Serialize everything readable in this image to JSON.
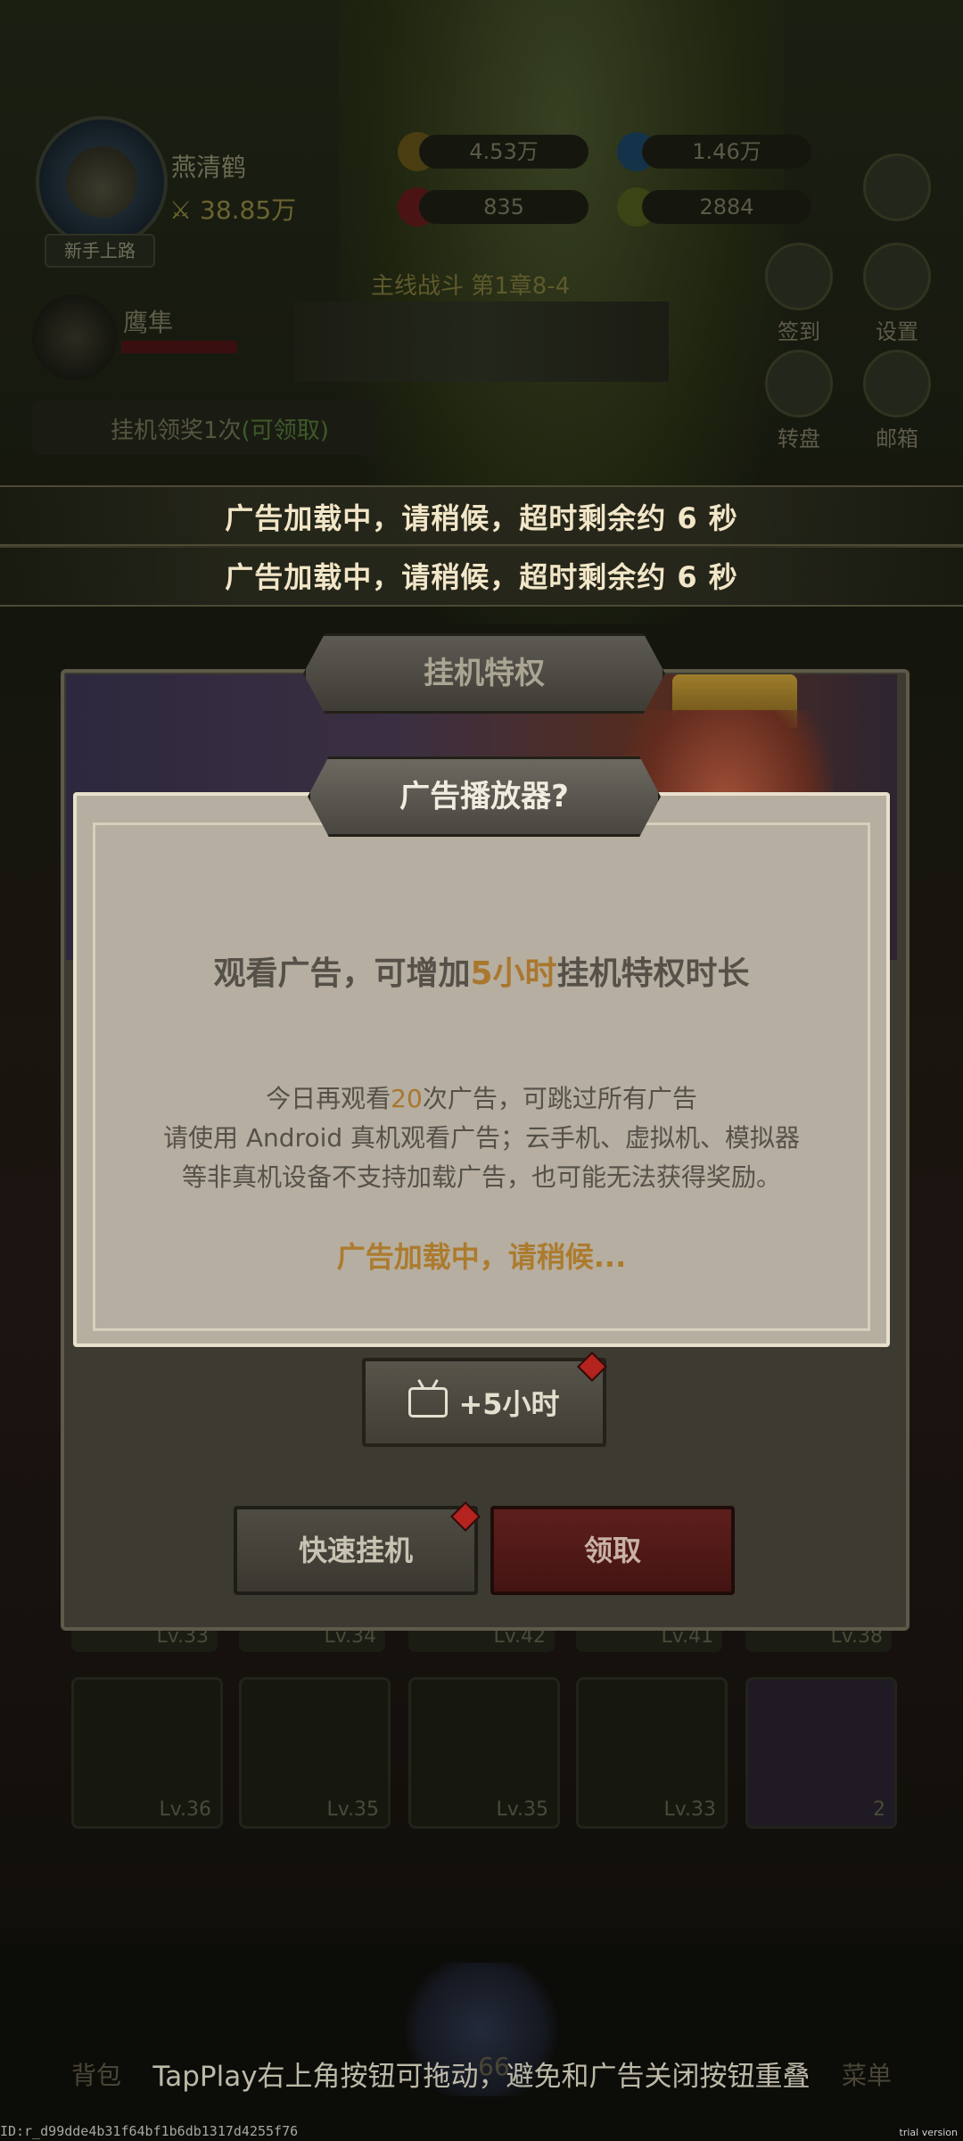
{
  "player": {
    "name": "燕清鹤",
    "power": "38.85万",
    "title_tag": "新手上路"
  },
  "resources": {
    "gold": "4.53万",
    "diamond": "1.46万",
    "gem": "835",
    "material": "2884"
  },
  "side_menu": {
    "checkin": "签到",
    "settings": "设置",
    "wheel": "转盘",
    "mail": "邮箱"
  },
  "pet": {
    "name": "鹰隼"
  },
  "stage": {
    "title": "主线战斗 第1章8-4"
  },
  "afk": {
    "label": "挂机领奖1次",
    "claimable": "(可领取)"
  },
  "toasts": [
    "广告加载中，请稍候，超时剩余约 6 秒",
    "广告加载中，请稍候，超时剩余约 6 秒"
  ],
  "back_panel": {
    "title": "挂机特权",
    "ad_button": "+5小时",
    "quick_afk_button": "快速挂机",
    "claim_button": "领取"
  },
  "dialog": {
    "title": "广告播放器?",
    "main_prefix": "观看广告，可增加",
    "main_highlight": "5小时",
    "main_suffix": "挂机特权时长",
    "line1_prefix": "今日再观看",
    "line1_highlight": "20",
    "line1_suffix": "次广告，可跳过所有广告",
    "line2": "请使用 Android 真机观看广告；云手机、虚拟机、模拟器",
    "line3": "等非真机设备不支持加载广告，也可能无法获得奖励。",
    "loading": "广告加载中，请稍候..."
  },
  "inventory": {
    "row1_levels": [
      "Lv.33",
      "Lv.34",
      "Lv.42",
      "Lv.41",
      "Lv.38"
    ],
    "row2_levels": [
      "Lv.36",
      "Lv.35",
      "Lv.35",
      "Lv.33",
      "2"
    ]
  },
  "bottom_nav": {
    "bag": "背包",
    "menu": "菜单",
    "center_level": "66"
  },
  "tapplay_tip": "TapPlay右上角按钮可拖动，避免和广告关闭按钮重叠",
  "id_text": "ID:r_d99dde4b31f64bf1b6db1317d4255f76",
  "trial_text": "trial version",
  "colors": {
    "highlight": "#a9772e",
    "toast_text": "#f2e6c8",
    "claim_red": "#5d1f1c"
  }
}
